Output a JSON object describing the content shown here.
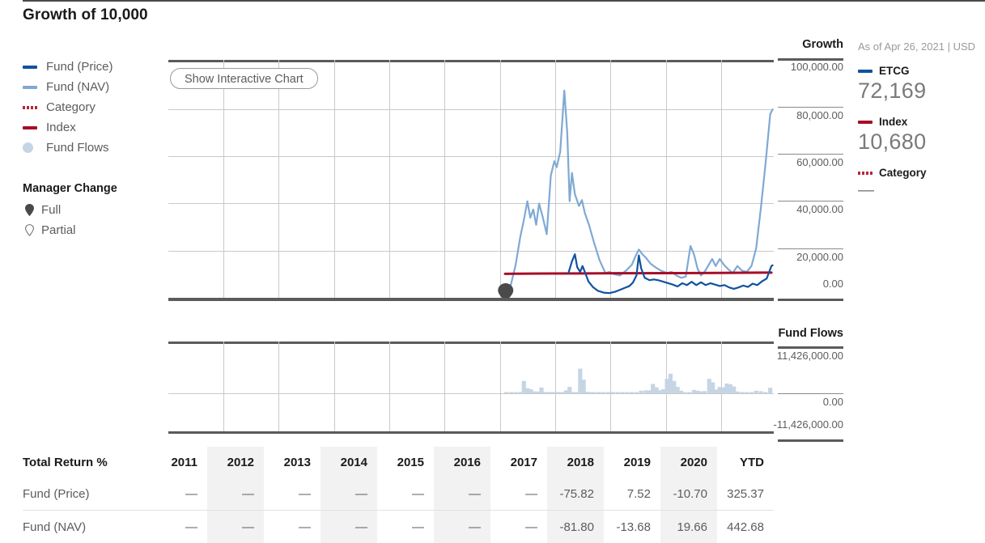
{
  "header": {
    "title": "Growth of 10,000",
    "top_rule": true
  },
  "legend": {
    "series": [
      {
        "label": "Fund (Price)",
        "marker": "line-swatch-navy",
        "color": "#10529f"
      },
      {
        "label": "Fund (NAV)",
        "marker": "line-swatch-lightblue",
        "color": "#7fa9d4"
      },
      {
        "label": "Category",
        "marker": "dotted-swatch-red",
        "color": "#b8253f"
      },
      {
        "label": "Index",
        "marker": "line-swatch-crimson",
        "color": "#a50e28"
      },
      {
        "label": "Fund Flows",
        "marker": "circle-swatch",
        "color": "#c5d5e4"
      }
    ],
    "manager_change": {
      "title": "Manager Change",
      "items": [
        {
          "label": "Full",
          "marker": "pin-filled-icon"
        },
        {
          "label": "Partial",
          "marker": "pin-outline-icon"
        }
      ]
    }
  },
  "chart_toolbar": {
    "interactive_button": "Show Interactive Chart"
  },
  "growth_axis": {
    "heading": "Growth",
    "ticks": [
      "100,000.00",
      "80,000.00",
      "60,000.00",
      "40,000.00",
      "20,000.00",
      "0.00"
    ]
  },
  "flows_axis": {
    "heading": "Fund Flows",
    "ticks": [
      "11,426,000.00",
      "0.00",
      "-11,426,000.00"
    ]
  },
  "right_panel": {
    "as_of": "As of Apr 26, 2021 | USD",
    "entries": [
      {
        "marker": "line-swatch-navy",
        "name": "ETCG",
        "value": "72,169",
        "color": "#10529f"
      },
      {
        "marker": "line-swatch-crimson",
        "name": "Index",
        "value": "10,680",
        "color": "#a50e28"
      },
      {
        "marker": "dotted-swatch-red",
        "name": "Category",
        "value": "—",
        "color": "#b8253f"
      }
    ]
  },
  "table": {
    "row_label_header": "Total Return %",
    "columns": [
      "2011",
      "2012",
      "2013",
      "2014",
      "2015",
      "2016",
      "2017",
      "2018",
      "2019",
      "2020",
      "YTD"
    ],
    "shaded_columns": [
      "2012",
      "2014",
      "2016",
      "2018",
      "2020"
    ],
    "rows": [
      {
        "label": "Fund (Price)",
        "values": [
          "—",
          "—",
          "—",
          "—",
          "—",
          "—",
          "—",
          "-75.82",
          "7.52",
          "-10.70",
          "325.37"
        ]
      },
      {
        "label": "Fund (NAV)",
        "values": [
          "—",
          "—",
          "—",
          "—",
          "—",
          "—",
          "—",
          "-81.80",
          "-13.68",
          "19.66",
          "442.68"
        ]
      }
    ]
  },
  "chart_data": {
    "type": "line",
    "title": "Growth of 10,000",
    "ylabel": "Growth",
    "ylim": [
      0,
      100000
    ],
    "yticks": [
      0,
      20000,
      40000,
      60000,
      80000,
      100000
    ],
    "xlim": [
      2011,
      2021.32
    ],
    "xticks": [
      2011,
      2012,
      2013,
      2014,
      2015,
      2016,
      2017,
      2018,
      2019,
      2020,
      2021
    ],
    "grid": true,
    "legend_position": "left",
    "annotations": [
      {
        "type": "manager-change-full",
        "x": 2016.75,
        "y": 0,
        "label": "Full"
      }
    ],
    "series": [
      {
        "name": "Fund (NAV)",
        "color": "#7fa9d4",
        "points": [
          [
            2016.72,
            1200
          ],
          [
            2016.8,
            1500
          ],
          [
            2016.92,
            14000
          ],
          [
            2017.0,
            26000
          ],
          [
            2017.06,
            33000
          ],
          [
            2017.12,
            41000
          ],
          [
            2017.17,
            34000
          ],
          [
            2017.22,
            37500
          ],
          [
            2017.27,
            31000
          ],
          [
            2017.32,
            40000
          ],
          [
            2017.38,
            34500
          ],
          [
            2017.45,
            27000
          ],
          [
            2017.52,
            52000
          ],
          [
            2017.58,
            58000
          ],
          [
            2017.62,
            55500
          ],
          [
            2017.68,
            62000
          ],
          [
            2017.75,
            88000
          ],
          [
            2017.8,
            70000
          ],
          [
            2017.84,
            41000
          ],
          [
            2017.88,
            53000
          ],
          [
            2017.93,
            44000
          ],
          [
            2018.0,
            39000
          ],
          [
            2018.05,
            41500
          ],
          [
            2018.1,
            36000
          ],
          [
            2018.17,
            31000
          ],
          [
            2018.25,
            24000
          ],
          [
            2018.35,
            16000
          ],
          [
            2018.45,
            10500
          ],
          [
            2018.52,
            11000
          ],
          [
            2018.6,
            10000
          ],
          [
            2018.7,
            9500
          ],
          [
            2018.8,
            11500
          ],
          [
            2018.9,
            14000
          ],
          [
            2018.96,
            17500
          ],
          [
            2019.02,
            20500
          ],
          [
            2019.08,
            18500
          ],
          [
            2019.14,
            17000
          ],
          [
            2019.22,
            14500
          ],
          [
            2019.3,
            13000
          ],
          [
            2019.4,
            11500
          ],
          [
            2019.5,
            10500
          ],
          [
            2019.58,
            11000
          ],
          [
            2019.66,
            9500
          ],
          [
            2019.74,
            8500
          ],
          [
            2019.82,
            9000
          ],
          [
            2019.9,
            22000
          ],
          [
            2019.96,
            18500
          ],
          [
            2020.02,
            12500
          ],
          [
            2020.08,
            9500
          ],
          [
            2020.14,
            11000
          ],
          [
            2020.2,
            13500
          ],
          [
            2020.27,
            16500
          ],
          [
            2020.33,
            13500
          ],
          [
            2020.4,
            16500
          ],
          [
            2020.47,
            14000
          ],
          [
            2020.55,
            12000
          ],
          [
            2020.62,
            10500
          ],
          [
            2020.7,
            13500
          ],
          [
            2020.78,
            11500
          ],
          [
            2020.86,
            11000
          ],
          [
            2020.94,
            13500
          ],
          [
            2021.02,
            21000
          ],
          [
            2021.1,
            38000
          ],
          [
            2021.18,
            57000
          ],
          [
            2021.26,
            78000
          ],
          [
            2021.3,
            80000
          ]
        ]
      },
      {
        "name": "Fund (Price)",
        "color": "#10529f",
        "points": [
          [
            2017.82,
            10500
          ],
          [
            2017.88,
            15500
          ],
          [
            2017.93,
            18500
          ],
          [
            2017.97,
            13000
          ],
          [
            2018.02,
            11000
          ],
          [
            2018.06,
            13500
          ],
          [
            2018.1,
            11000
          ],
          [
            2018.16,
            7000
          ],
          [
            2018.24,
            4500
          ],
          [
            2018.32,
            3000
          ],
          [
            2018.42,
            2200
          ],
          [
            2018.52,
            2000
          ],
          [
            2018.62,
            2600
          ],
          [
            2018.7,
            3400
          ],
          [
            2018.78,
            4200
          ],
          [
            2018.86,
            5000
          ],
          [
            2018.92,
            6500
          ],
          [
            2018.98,
            9500
          ],
          [
            2019.02,
            18000
          ],
          [
            2019.06,
            12500
          ],
          [
            2019.12,
            8500
          ],
          [
            2019.2,
            7500
          ],
          [
            2019.28,
            7800
          ],
          [
            2019.36,
            7400
          ],
          [
            2019.44,
            6800
          ],
          [
            2019.52,
            6200
          ],
          [
            2019.6,
            5600
          ],
          [
            2019.68,
            4800
          ],
          [
            2019.76,
            6200
          ],
          [
            2019.84,
            5400
          ],
          [
            2019.92,
            6800
          ],
          [
            2020.0,
            5400
          ],
          [
            2020.08,
            6600
          ],
          [
            2020.16,
            5400
          ],
          [
            2020.24,
            6200
          ],
          [
            2020.32,
            5600
          ],
          [
            2020.4,
            5000
          ],
          [
            2020.48,
            5400
          ],
          [
            2020.56,
            4400
          ],
          [
            2020.64,
            3800
          ],
          [
            2020.72,
            4400
          ],
          [
            2020.8,
            5200
          ],
          [
            2020.88,
            4600
          ],
          [
            2020.96,
            6000
          ],
          [
            2021.04,
            5400
          ],
          [
            2021.12,
            7000
          ],
          [
            2021.2,
            8200
          ],
          [
            2021.28,
            13500
          ],
          [
            2021.3,
            13800
          ]
        ]
      },
      {
        "name": "Index",
        "color": "#a50e28",
        "points": [
          [
            2016.74,
            10200
          ],
          [
            2017.4,
            10300
          ],
          [
            2018.1,
            10350
          ],
          [
            2018.9,
            10450
          ],
          [
            2019.7,
            10500
          ],
          [
            2020.4,
            10580
          ],
          [
            2021.1,
            10680
          ],
          [
            2021.28,
            10680
          ]
        ]
      }
    ],
    "flows": {
      "name": "Fund Flows",
      "color": "#c5d5e4",
      "ylim": [
        -11426000,
        11426000
      ],
      "bars": [
        [
          2016.76,
          80000
        ],
        [
          2016.84,
          90000
        ],
        [
          2016.92,
          70000
        ],
        [
          2017.0,
          120000
        ],
        [
          2017.06,
          2900000
        ],
        [
          2017.12,
          1200000
        ],
        [
          2017.18,
          950000
        ],
        [
          2017.24,
          450000
        ],
        [
          2017.3,
          400000
        ],
        [
          2017.36,
          1350000
        ],
        [
          2017.42,
          300000
        ],
        [
          2017.48,
          260000
        ],
        [
          2017.54,
          200000
        ],
        [
          2017.6,
          240000
        ],
        [
          2017.66,
          200000
        ],
        [
          2017.72,
          180000
        ],
        [
          2017.78,
          700000
        ],
        [
          2017.84,
          1500000
        ],
        [
          2017.9,
          260000
        ],
        [
          2017.96,
          220000
        ],
        [
          2018.02,
          5800000
        ],
        [
          2018.08,
          3200000
        ],
        [
          2018.14,
          350000
        ],
        [
          2018.2,
          260000
        ],
        [
          2018.26,
          200000
        ],
        [
          2018.34,
          180000
        ],
        [
          2018.42,
          150000
        ],
        [
          2018.5,
          230000
        ],
        [
          2018.58,
          150000
        ],
        [
          2018.66,
          130000
        ],
        [
          2018.74,
          160000
        ],
        [
          2018.82,
          170000
        ],
        [
          2018.9,
          150000
        ],
        [
          2018.98,
          160000
        ],
        [
          2019.06,
          600000
        ],
        [
          2019.14,
          700000
        ],
        [
          2019.2,
          680000
        ],
        [
          2019.26,
          2200000
        ],
        [
          2019.32,
          1400000
        ],
        [
          2019.38,
          700000
        ],
        [
          2019.44,
          950000
        ],
        [
          2019.5,
          3400000
        ],
        [
          2019.56,
          4600000
        ],
        [
          2019.62,
          2900000
        ],
        [
          2019.68,
          1500000
        ],
        [
          2019.74,
          600000
        ],
        [
          2019.8,
          280000
        ],
        [
          2019.88,
          250000
        ],
        [
          2019.96,
          800000
        ],
        [
          2020.02,
          600000
        ],
        [
          2020.08,
          450000
        ],
        [
          2020.14,
          520000
        ],
        [
          2020.22,
          3400000
        ],
        [
          2020.28,
          2600000
        ],
        [
          2020.34,
          900000
        ],
        [
          2020.4,
          1500000
        ],
        [
          2020.46,
          1400000
        ],
        [
          2020.52,
          2300000
        ],
        [
          2020.58,
          2100000
        ],
        [
          2020.64,
          1600000
        ],
        [
          2020.7,
          420000
        ],
        [
          2020.78,
          300000
        ],
        [
          2020.86,
          260000
        ],
        [
          2020.94,
          280000
        ],
        [
          2021.02,
          600000
        ],
        [
          2021.1,
          500000
        ],
        [
          2021.18,
          240000
        ],
        [
          2021.26,
          1300000
        ]
      ]
    }
  }
}
